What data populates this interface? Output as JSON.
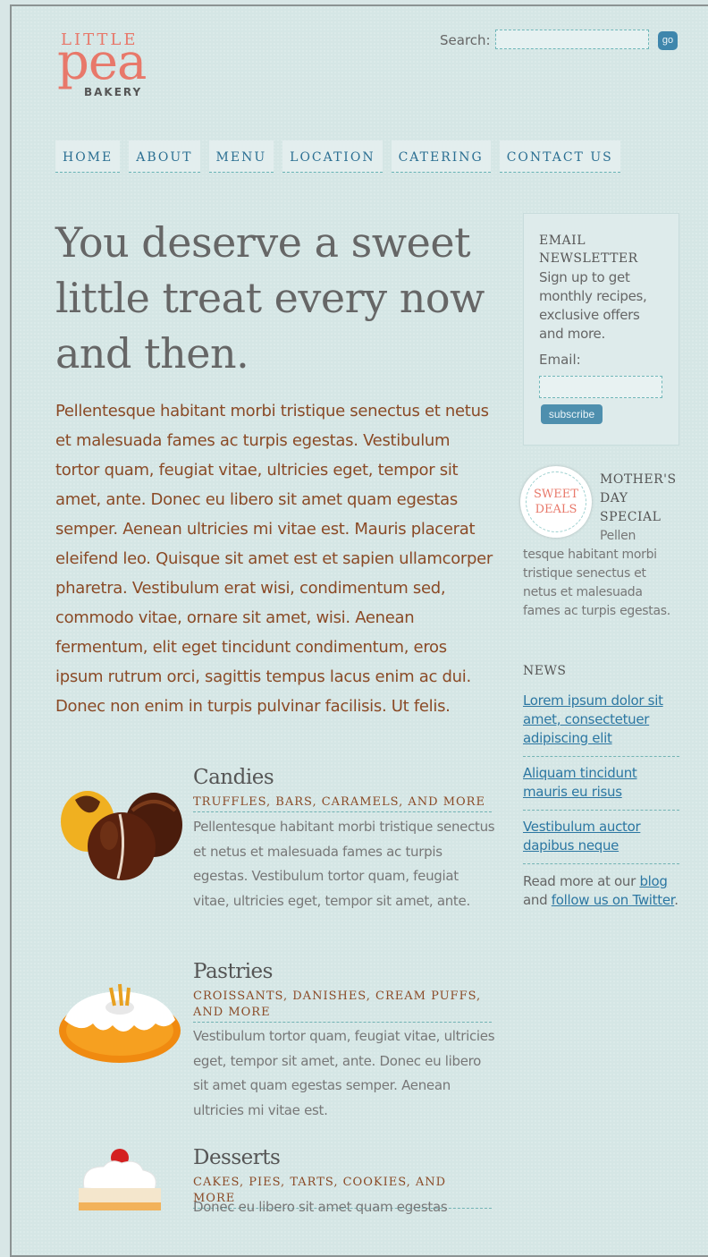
{
  "logo": {
    "top": "LITTLE",
    "main": "pea",
    "bottom": "BAKERY"
  },
  "search": {
    "label": "Search:",
    "value": "",
    "button": "go"
  },
  "nav": [
    "HOME",
    "ABOUT",
    "MENU",
    "LOCATION",
    "CATERING",
    "CONTACT US"
  ],
  "hero": {
    "headline": "You deserve a sweet little treat every now and then.",
    "intro": "Pellentesque habitant morbi tristique senectus et netus et malesuada fames ac turpis egestas. Vestibulum tortor quam, feugiat vitae, ultricies eget, tempor sit amet, ante. Donec eu libero sit amet quam egestas semper. Aenean ultricies mi vitae est. Mauris placerat eleifend leo. Quisque sit amet est et sapien ullamcorper pharetra. Vestibulum erat wisi, condimentum sed, commodo vitae, ornare sit amet, wisi. Aenean fermentum, elit eget tincidunt condimentum, eros ipsum rutrum orci, sagittis tempus lacus enim ac dui. Donec non enim in turpis pulvinar facilisis. Ut felis."
  },
  "products": [
    {
      "title": "Candies",
      "subtitle": "TRUFFLES, BARS, CARAMELS, AND MORE",
      "description": "Pellentesque habitant morbi tristique senectus et netus et malesuada fames ac turpis egestas. Vestibulum tortor quam, feugiat vitae, ultricies eget, tempor sit amet, ante.",
      "icon": "chocolate-truffles-icon"
    },
    {
      "title": "Pastries",
      "subtitle": "CROISSANTS, DANISHES, CREAM PUFFS, AND MORE",
      "description": "Vestibulum tortor quam, feugiat vitae, ultricies eget, tempor sit amet, ante. Donec eu libero sit amet quam egestas semper. Aenean ultricies mi vitae est.",
      "icon": "bundt-cake-icon"
    },
    {
      "title": "Desserts",
      "subtitle": "CAKES, PIES, TARTS, COOKIES, AND MORE",
      "description": "Donec eu libero sit amet quam egestas",
      "icon": "cupcake-icon"
    }
  ],
  "newsletter": {
    "title": "EMAIL NEWSLETTER",
    "text": "Sign up to get monthly recipes, exclusive offers and more.",
    "email_label": "Email:",
    "email_value": "",
    "button": "subscribe"
  },
  "special": {
    "badge": "SWEET DEALS",
    "title": "MOTHER'S DAY SPECIAL",
    "text": "Pellen tesque habitant morbi tristique senectus et netus et malesuada fames ac turpis egestas."
  },
  "news": {
    "title": "NEWS",
    "items": [
      "Lorem ipsum dolor sit amet, consectetuer adipiscing elit",
      "Aliquam tincidunt mauris eu risus",
      "Vestibulum auctor dapibus neque"
    ],
    "read_more": {
      "prefix": "Read more at our ",
      "blog": "blog",
      "middle": " and ",
      "follow": "follow us on Twitter",
      "suffix": "."
    }
  },
  "colors": {
    "accent": "#e8786a",
    "link": "#2c77a2",
    "text_brown": "#8a4a26",
    "background": "#d5e6e5"
  }
}
